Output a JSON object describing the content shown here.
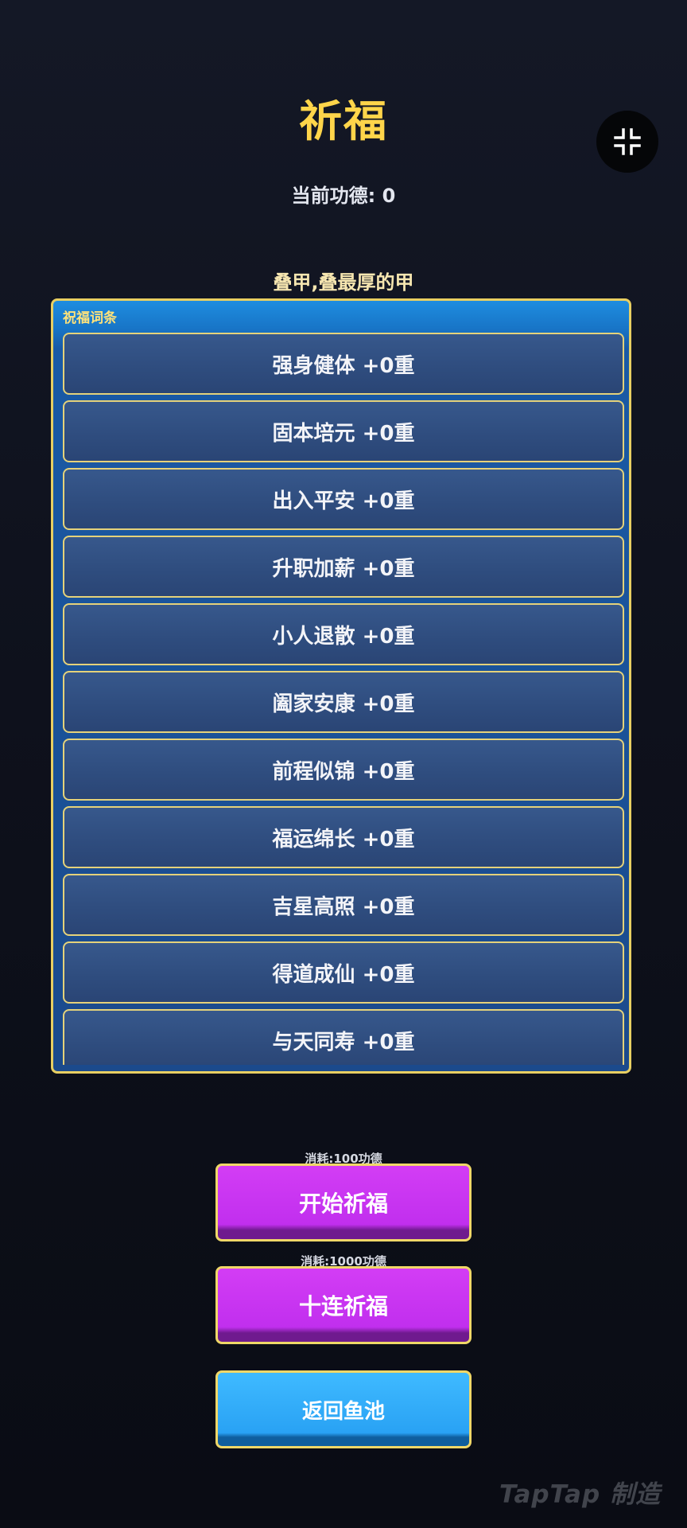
{
  "header": {
    "title": "祈福",
    "merit_text": "当前功德: 0",
    "subtitle": "叠甲,叠最厚的甲"
  },
  "panel": {
    "label": "祝福词条",
    "entries": [
      "强身健体 +0重",
      "固本培元 +0重",
      "出入平安 +0重",
      "升职加薪 +0重",
      "小人退散 +0重",
      "阖家安康 +0重",
      "前程似锦 +0重",
      "福运绵长 +0重",
      "吉星高照 +0重",
      "得道成仙 +0重",
      "与天同寿 +0重"
    ]
  },
  "actions": {
    "single_cost": "消耗:100功德",
    "single_label": "开始祈福",
    "ten_cost": "消耗:1000功德",
    "ten_label": "十连祈福",
    "back_label": "返回鱼池"
  },
  "watermark": "TapTap 制造",
  "icons": {
    "collapse": "collapse-icon"
  },
  "colors": {
    "title": "#ffd54a",
    "panel_border": "#e8cf62",
    "button_purple": "#c12fee",
    "button_blue": "#29a2f4"
  }
}
